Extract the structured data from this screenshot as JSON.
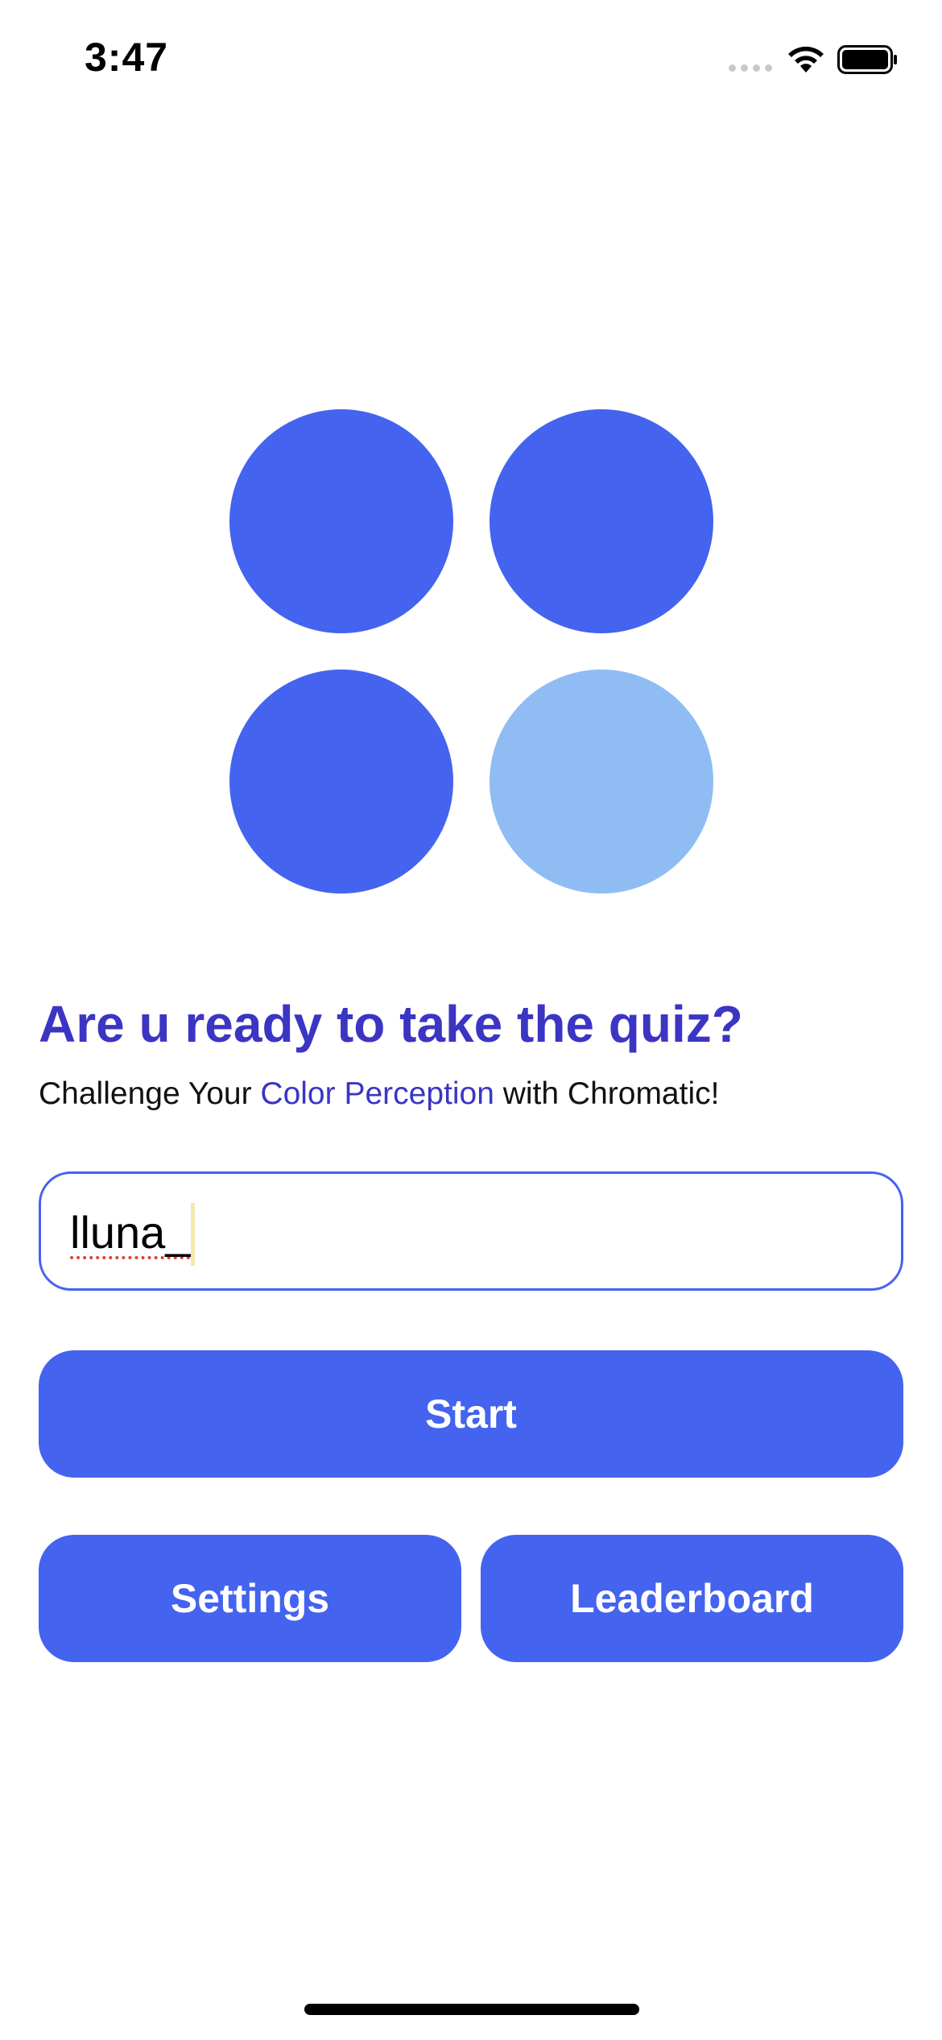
{
  "status_bar": {
    "time": "3:47",
    "icons": [
      "cellular-signal-icon",
      "wifi-icon",
      "battery-icon"
    ]
  },
  "logo": {
    "dots": [
      {
        "name": "dot-top-left",
        "color": "#4463ef"
      },
      {
        "name": "dot-top-right",
        "color": "#4463ef"
      },
      {
        "name": "dot-bottom-left",
        "color": "#4463ef"
      },
      {
        "name": "dot-bottom-right",
        "color": "#8fbdf3"
      }
    ]
  },
  "headline": "Are u ready to take the quiz?",
  "subline": {
    "prefix": "Challenge Your ",
    "highlight": "Color Perception",
    "suffix": " with Chromatic!"
  },
  "name_input": {
    "value": "lluna_"
  },
  "buttons": {
    "start": "Start",
    "settings": "Settings",
    "leaderboard": "Leaderboard"
  },
  "colors": {
    "primary": "#4463ef",
    "headline": "#3b35c4",
    "highlight": "#3b35c4",
    "light_dot": "#8fbdf3",
    "input_border": "#4463ef"
  }
}
